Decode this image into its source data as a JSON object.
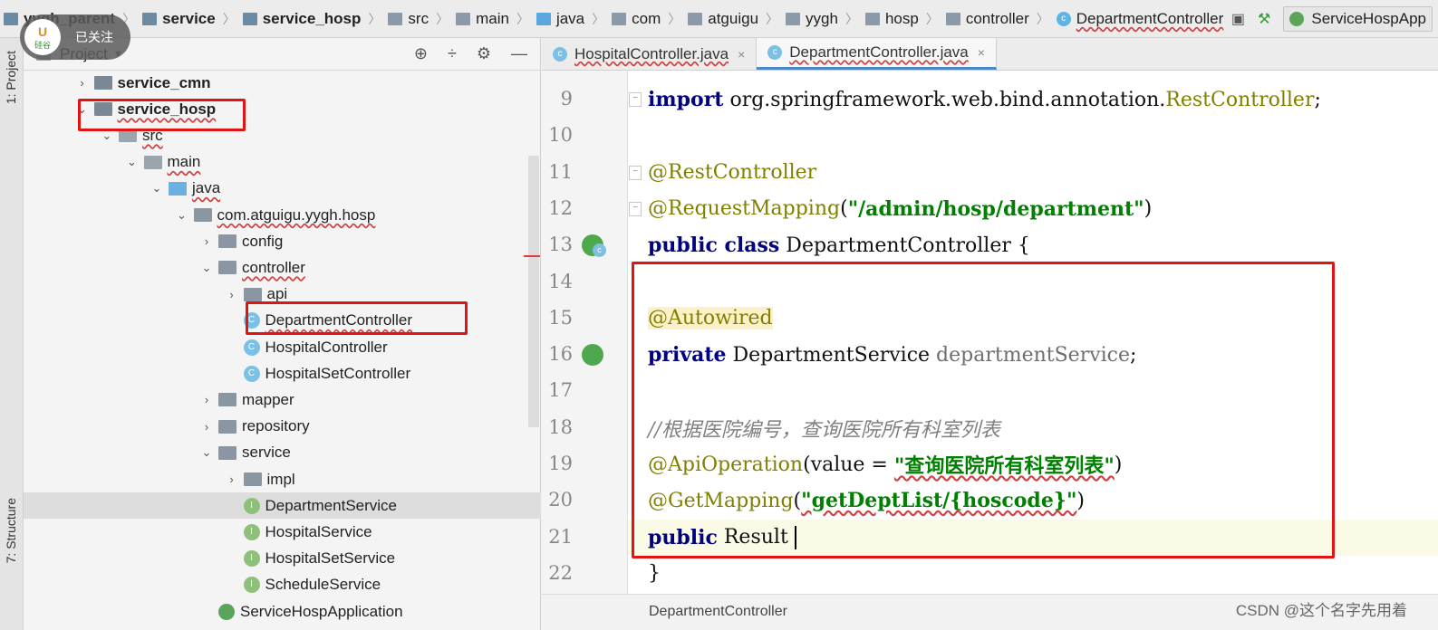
{
  "breadcrumbs": [
    {
      "label": "yygh_parent",
      "icon": "module-folder-icon",
      "bold": true
    },
    {
      "label": "service",
      "icon": "module-folder-icon",
      "bold": true
    },
    {
      "label": "service_hosp",
      "icon": "module-folder-icon",
      "bold": true
    },
    {
      "label": "src",
      "icon": "folder-icon",
      "bold": false
    },
    {
      "label": "main",
      "icon": "folder-icon",
      "bold": false
    },
    {
      "label": "java",
      "icon": "source-folder-icon",
      "bold": false
    },
    {
      "label": "com",
      "icon": "package-icon",
      "bold": false
    },
    {
      "label": "atguigu",
      "icon": "package-icon",
      "bold": false
    },
    {
      "label": "yygh",
      "icon": "package-icon",
      "bold": false
    },
    {
      "label": "hosp",
      "icon": "package-icon",
      "bold": false
    },
    {
      "label": "controller",
      "icon": "package-icon",
      "bold": false
    },
    {
      "label": "DepartmentController",
      "icon": "class-icon",
      "bold": false
    }
  ],
  "run_config": "ServiceHospApp",
  "follow_badge": {
    "text": "已关注",
    "logo_text": "U\n硅谷"
  },
  "side_tabs": {
    "project": "1: Project",
    "structure": "7: Structure"
  },
  "project_panel": {
    "title": "Project",
    "tree": [
      {
        "label": "service_cmn",
        "arrow": "›",
        "icon": "module",
        "indent": 1,
        "bold": true,
        "wavy": false
      },
      {
        "label": "service_hosp",
        "arrow": "⌄",
        "icon": "module",
        "indent": 1,
        "bold": true,
        "wavy": true
      },
      {
        "label": "src",
        "arrow": "⌄",
        "icon": "src",
        "indent": 2,
        "bold": false,
        "wavy": true
      },
      {
        "label": "main",
        "arrow": "⌄",
        "icon": "src",
        "indent": 3,
        "bold": false,
        "wavy": true
      },
      {
        "label": "java",
        "arrow": "⌄",
        "icon": "blue",
        "indent": 4,
        "bold": false,
        "wavy": true
      },
      {
        "label": "com.atguigu.yygh.hosp",
        "arrow": "⌄",
        "icon": "pkg",
        "indent": 5,
        "bold": false,
        "wavy": true
      },
      {
        "label": "config",
        "arrow": "›",
        "icon": "pkg",
        "indent": 6,
        "bold": false,
        "wavy": false
      },
      {
        "label": "controller",
        "arrow": "⌄",
        "icon": "pkg",
        "indent": 6,
        "bold": false,
        "wavy": true
      },
      {
        "label": "api",
        "arrow": "›",
        "icon": "pkg",
        "indent": 7,
        "bold": false,
        "wavy": false
      },
      {
        "label": "DepartmentController",
        "arrow": "",
        "icon": "class",
        "indent": 7,
        "bold": false,
        "wavy": true
      },
      {
        "label": "HospitalController",
        "arrow": "",
        "icon": "class",
        "indent": 7,
        "bold": false,
        "wavy": false
      },
      {
        "label": "HospitalSetController",
        "arrow": "",
        "icon": "class",
        "indent": 7,
        "bold": false,
        "wavy": false
      },
      {
        "label": "mapper",
        "arrow": "›",
        "icon": "pkg",
        "indent": 6,
        "bold": false,
        "wavy": false
      },
      {
        "label": "repository",
        "arrow": "›",
        "icon": "pkg",
        "indent": 6,
        "bold": false,
        "wavy": false
      },
      {
        "label": "service",
        "arrow": "⌄",
        "icon": "pkg",
        "indent": 6,
        "bold": false,
        "wavy": false
      },
      {
        "label": "impl",
        "arrow": "›",
        "icon": "pkg",
        "indent": 7,
        "bold": false,
        "wavy": false
      },
      {
        "label": "DepartmentService",
        "arrow": "",
        "icon": "interface",
        "indent": 7,
        "bold": false,
        "wavy": false,
        "selected": true
      },
      {
        "label": "HospitalService",
        "arrow": "",
        "icon": "interface",
        "indent": 7,
        "bold": false,
        "wavy": false
      },
      {
        "label": "HospitalSetService",
        "arrow": "",
        "icon": "interface",
        "indent": 7,
        "bold": false,
        "wavy": false
      },
      {
        "label": "ScheduleService",
        "arrow": "",
        "icon": "interface",
        "indent": 7,
        "bold": false,
        "wavy": false
      },
      {
        "label": "ServiceHospApplication",
        "arrow": "",
        "icon": "app",
        "indent": 6,
        "bold": false,
        "wavy": false
      }
    ]
  },
  "editor": {
    "tabs": [
      {
        "label": "HospitalController.java",
        "active": false
      },
      {
        "label": "DepartmentController.java",
        "active": true
      }
    ],
    "lines": [
      {
        "n": "9",
        "html": "<span class=\"kw\">import</span> org.springframework.web.bind.annotation.<span class=\"ann\">RestController</span>;"
      },
      {
        "n": "10",
        "html": ""
      },
      {
        "n": "11",
        "html": "<span class=\"ann\">@RestController</span>"
      },
      {
        "n": "12",
        "html": "<span class=\"ann\">@RequestMapping</span>(<span class=\"str\">\"/admin/hosp/department\"</span>)"
      },
      {
        "n": "13",
        "html": "<span class=\"kw\">public class</span> DepartmentController {"
      },
      {
        "n": "14",
        "html": ""
      },
      {
        "n": "15",
        "html": "    <span class=\"ann annbg\">@Autowired</span>"
      },
      {
        "n": "16",
        "html": "    <span class=\"kw\">private</span> DepartmentService <span class=\"muted\">departmentService</span>;"
      },
      {
        "n": "17",
        "html": ""
      },
      {
        "n": "18",
        "html": "    <span class=\"cmt\">//根据医院编号，查询医院所有科室列表</span>"
      },
      {
        "n": "19",
        "html": "    <span class=\"ann\">@ApiOperation</span>(value = <span class=\"str lline\">\"查询医院所有科室列表\"</span>)"
      },
      {
        "n": "20",
        "html": "    <span class=\"ann\">@GetMapping</span>(<span class=\"str lline\">\"getDeptList/{hoscode}\"</span>)"
      },
      {
        "n": "21",
        "html": "    <span class=\"kw\">public</span> Result <span class=\"caret-bar\"></span>",
        "current": true
      },
      {
        "n": "22",
        "html": "}"
      }
    ]
  },
  "status_breadcrumb": "DepartmentController",
  "watermark": "CSDN @这个名字先用着",
  "colors": {
    "highlight_box": "#e11414",
    "keyword": "#000080",
    "annotation": "#808000",
    "string": "#008000",
    "comment": "#808080"
  }
}
